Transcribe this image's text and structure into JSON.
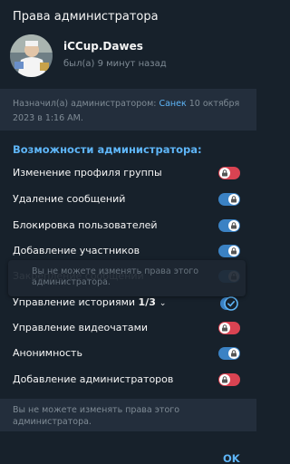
{
  "dialog": {
    "title": "Права администратора"
  },
  "user": {
    "name": "iCCup.Dawes",
    "status": "был(а) 9 минут назад"
  },
  "info": {
    "prefix": "Назначил(а) администратором: ",
    "admin_name": "Санек",
    "suffix": " 10 октября 2023 в 1:16 AM."
  },
  "section_title": "Возможности администратора:",
  "permissions": [
    {
      "label": "Изменение профиля группы",
      "state": "off"
    },
    {
      "label": "Удаление сообщений",
      "state": "on"
    },
    {
      "label": "Блокировка пользователей",
      "state": "on"
    },
    {
      "label": "Добавление участников",
      "state": "on"
    },
    {
      "label": "Закрепление сообщений",
      "state": "on"
    },
    {
      "label": "Управление историями",
      "count": "1/3",
      "state": "check",
      "icon": "chevron-down-icon"
    },
    {
      "label": "Управление видеочатами",
      "state": "off"
    },
    {
      "label": "Анонимность",
      "state": "on"
    },
    {
      "label": "Добавление администраторов",
      "state": "off"
    }
  ],
  "tooltip": "Вы не можете изменять права этого администратора.",
  "footer_note": "Вы не можете изменять права этого администратора.",
  "ok_label": "OK",
  "colors": {
    "background": "#17212b",
    "accent": "#5eb5f7",
    "toggle_on": "#3b82c4",
    "toggle_off": "#d94352",
    "muted": "#7f8b95"
  }
}
